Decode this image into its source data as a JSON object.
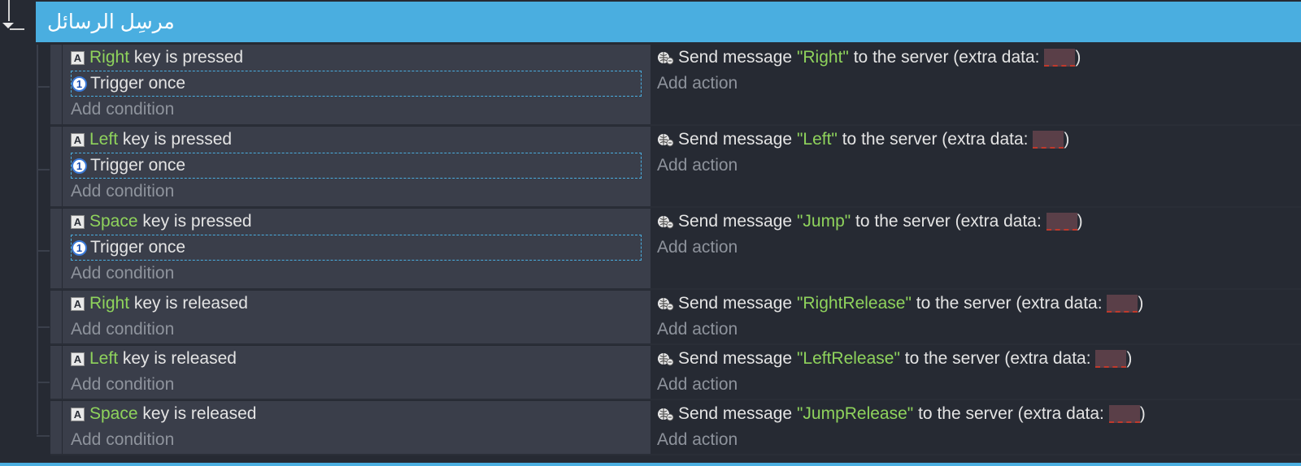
{
  "group": {
    "title": "مرسِل الرسائل"
  },
  "labels": {
    "add_condition": "Add condition",
    "add_action": "Add action",
    "trigger_once": "Trigger once",
    "send_prefix": "Send message",
    "send_mid": "to the server (extra data:",
    "send_suffix": ")"
  },
  "events": [
    {
      "key": "Right",
      "state": "key is pressed",
      "trigger_once": true,
      "message": "\"Right\""
    },
    {
      "key": "Left",
      "state": "key is pressed",
      "trigger_once": true,
      "message": "\"Left\""
    },
    {
      "key": "Space",
      "state": "key is pressed",
      "trigger_once": true,
      "message": "\"Jump\""
    },
    {
      "key": "Right",
      "state": "key is released",
      "trigger_once": false,
      "message": "\"RightRelease\""
    },
    {
      "key": "Left",
      "state": "key is released",
      "trigger_once": false,
      "message": "\"LeftRelease\""
    },
    {
      "key": "Space",
      "state": "key is released",
      "trigger_once": false,
      "message": "\"JumpRelease\""
    }
  ],
  "colors": {
    "header": "#4aaee0",
    "parameter": "#8fd35c",
    "background": "#262a33",
    "condition_bg": "#3a3e4a"
  },
  "icons": {
    "keyboard": "keyboard-key-icon",
    "trigger_once": "trigger-once-icon",
    "network": "send-message-icon",
    "collapse": "collapse-arrow-icon"
  }
}
